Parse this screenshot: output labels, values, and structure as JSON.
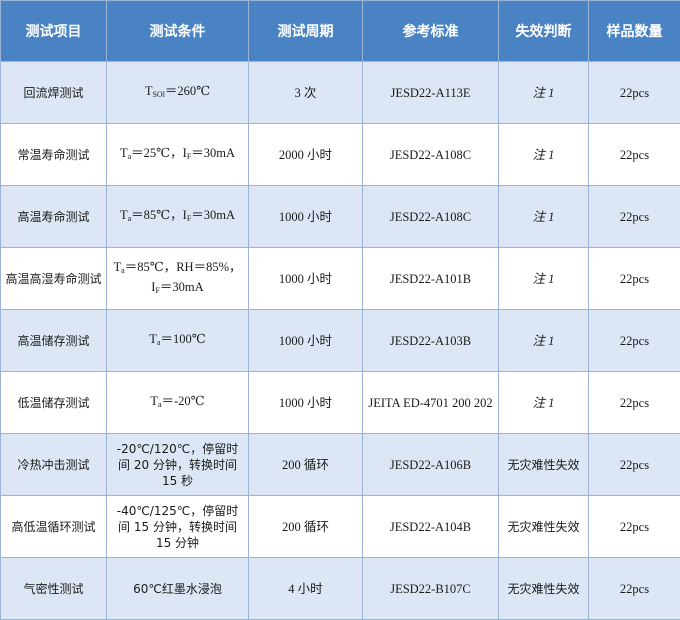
{
  "headers": [
    "测试项目",
    "测试条件",
    "测试周期",
    "参考标准",
    "失效判断",
    "样品数量"
  ],
  "rows": [
    {
      "item": "回流焊测试",
      "cond_pre": "T",
      "cond_sub": "SOl",
      "cond_post": "＝260℃",
      "cycle": "3 次",
      "std": "JESD22-A113E",
      "fail": "注 1",
      "fail_note": true,
      "qty": "22pcs"
    },
    {
      "item": "常温寿命测试",
      "cond_pre": "T",
      "cond_sub": "a",
      "cond_post": "＝25℃，I",
      "cond_sub2": "F",
      "cond_post2": "＝30mA",
      "cycle": "2000  小时",
      "std": "JESD22-A108C",
      "fail": "注 1",
      "fail_note": true,
      "qty": "22pcs"
    },
    {
      "item": "高温寿命测试",
      "cond_pre": "T",
      "cond_sub": "a",
      "cond_post": "＝85℃，I",
      "cond_sub2": "F",
      "cond_post2": "＝30mA",
      "cycle": "1000  小时",
      "std": "JESD22-A108C",
      "fail": "注 1",
      "fail_note": true,
      "qty": "22pcs"
    },
    {
      "item": "高温高湿寿命测试",
      "cond_pre": "T",
      "cond_sub": "a",
      "cond_post": "＝85℃，RH＝85%，",
      "cond_line2_pre": "I",
      "cond_line2_sub": "F",
      "cond_line2_post": "＝30mA",
      "cycle": "1000  小时",
      "std": "JESD22-A101B",
      "fail": "注 1",
      "fail_note": true,
      "qty": "22pcs"
    },
    {
      "item": "高温储存测试",
      "cond_pre": "T",
      "cond_sub": "a",
      "cond_post": "＝100℃",
      "cycle": "1000  小时",
      "std": "JESD22-A103B",
      "fail": "注 1",
      "fail_note": true,
      "qty": "22pcs"
    },
    {
      "item": "低温储存测试",
      "cond_pre": "T",
      "cond_sub": "a",
      "cond_post": "＝-20℃",
      "cycle": "1000  小时",
      "std": "JEITA ED-4701 200 202",
      "fail": "注 1",
      "fail_note": true,
      "qty": "22pcs"
    },
    {
      "item": "冷热冲击测试",
      "cond_text": "-20℃/120℃，停留时间 20 分钟，转换时间 15 秒",
      "cycle": "200 循环",
      "std": "JESD22-A106B",
      "fail": "无灾难性失效",
      "fail_note": false,
      "qty": "22pcs"
    },
    {
      "item": "高低温循环测试",
      "cond_text": "-40℃/125℃，停留时间 15 分钟，转换时间 15 分钟",
      "cycle": "200 循环",
      "std": "JESD22-A104B",
      "fail": "无灾难性失效",
      "fail_note": false,
      "qty": "22pcs"
    },
    {
      "item": "气密性测试",
      "cond_text": "60℃红墨水浸泡",
      "cycle": "4 小时",
      "std": "JESD22-B107C",
      "fail": "无灾难性失效",
      "fail_note": false,
      "qty": "22pcs"
    }
  ]
}
